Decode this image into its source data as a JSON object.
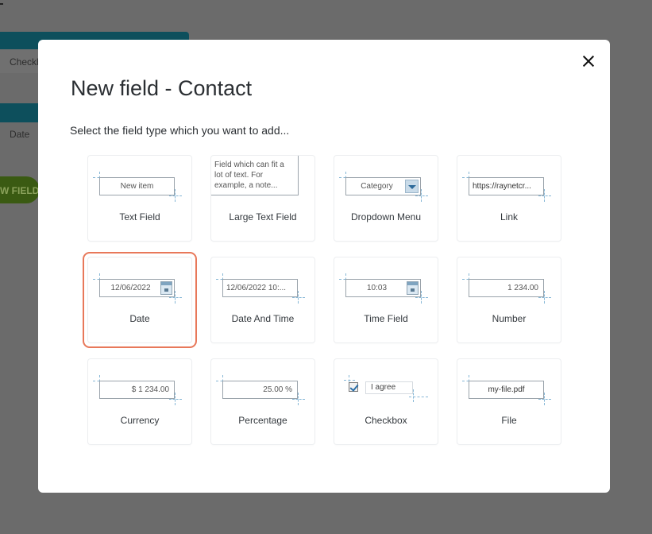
{
  "background": {
    "row1_text": "Checkb",
    "row2_text": "Date",
    "new_field_button": "W FIELD"
  },
  "modal": {
    "title": "New field - Contact",
    "subtitle": "Select the field type which you want to add...",
    "close_icon": "close-icon",
    "accent_color": "#e8785a",
    "field_types": [
      {
        "label": "Text Field",
        "preview": "New item"
      },
      {
        "label": "Large Text Field",
        "preview": "Field which can fit a lot of text. For example, a note..."
      },
      {
        "label": "Dropdown Menu",
        "preview": "Category"
      },
      {
        "label": "Link",
        "preview": "https://raynetcr..."
      },
      {
        "label": "Date",
        "preview": "12/06/2022",
        "selected": true
      },
      {
        "label": "Date And Time",
        "preview": "12/06/2022 10:..."
      },
      {
        "label": "Time Field",
        "preview": "10:03"
      },
      {
        "label": "Number",
        "preview": "1 234.00"
      },
      {
        "label": "Currency",
        "preview": "$ 1 234.00"
      },
      {
        "label": "Percentage",
        "preview": "25.00 %"
      },
      {
        "label": "Checkbox",
        "preview": "I agree"
      },
      {
        "label": "File",
        "preview": "my-file.pdf"
      }
    ]
  }
}
